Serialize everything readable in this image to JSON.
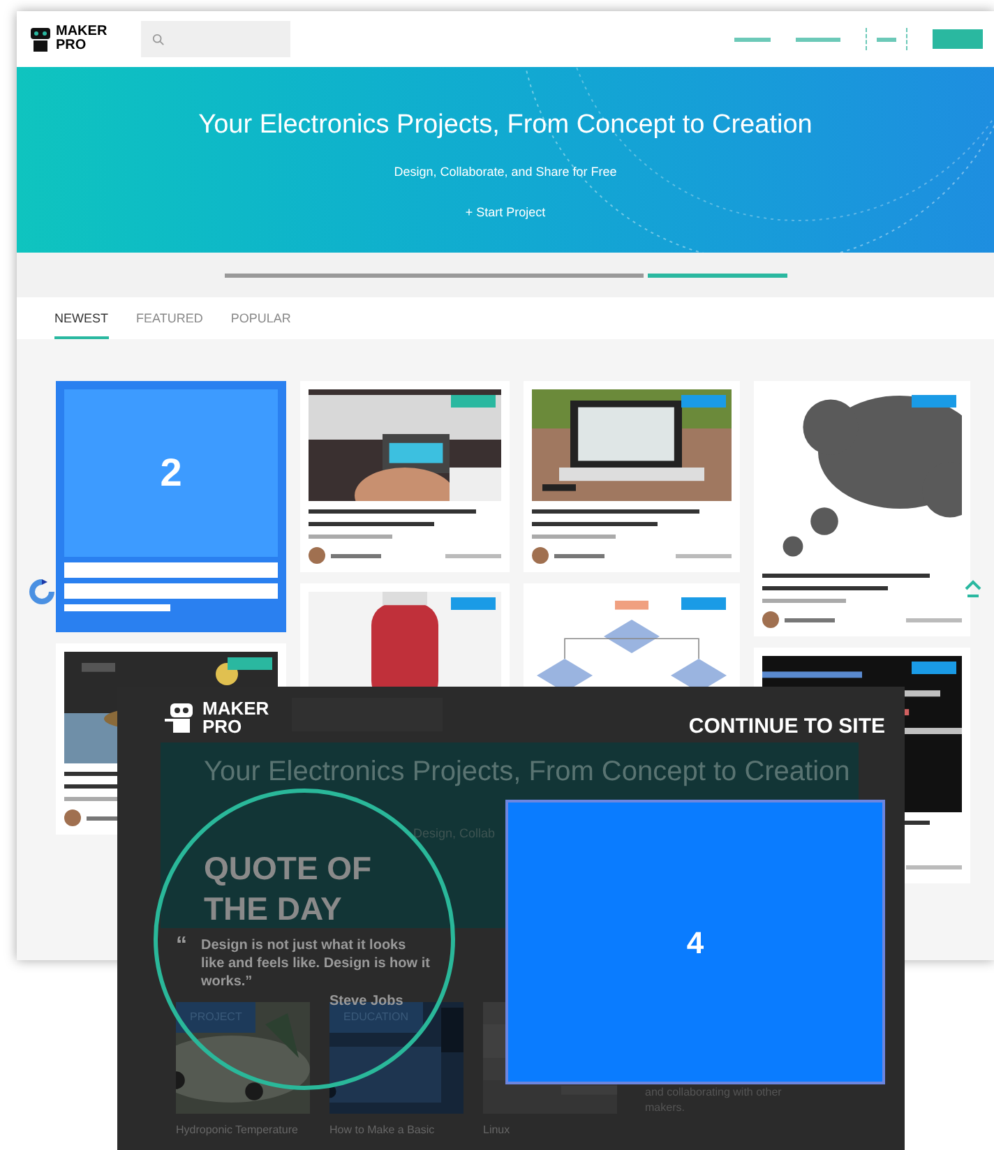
{
  "header": {
    "logo_top": "MAKER",
    "logo_bottom": "PRO"
  },
  "hero": {
    "title": "Your Electronics Projects, From Concept to Creation",
    "subtitle": "Design, Collaborate, and Share for Free",
    "button": "+ Start Project"
  },
  "tabs": [
    {
      "label": "NEWEST",
      "selected": true
    },
    {
      "label": "FEATURED",
      "selected": false
    },
    {
      "label": "POPULAR",
      "selected": false
    }
  ],
  "columns": [
    [
      {
        "kind": "placeholder",
        "number": "2"
      },
      {
        "kind": "card",
        "color": "#2ab8a0"
      }
    ],
    [
      {
        "kind": "card",
        "color": "#2ab8a0"
      },
      {
        "kind": "card",
        "color": "#1a9be6"
      }
    ],
    [
      {
        "kind": "card",
        "color": "#1a9be6"
      },
      {
        "kind": "card",
        "color": "#1a9be6"
      }
    ],
    [
      {
        "kind": "card",
        "color": "#1a9be6"
      },
      {
        "kind": "card",
        "color": "#1a9be6"
      }
    ]
  ],
  "overlay": {
    "logo_top": "MAKER",
    "logo_bottom": "PRO",
    "continue": "CONTINUE TO SITE",
    "dim_title": "Your Electronics Projects, From Concept to Creation",
    "dim_subtitle": "Design, Collab",
    "quote_heading": "QUOTE OF THE DAY",
    "quote_mark": "“",
    "quote": "Design is not just what it looks like and feels like. Design is how it works.”",
    "author": "Steve Jobs",
    "placeholder": "4",
    "dim_cards": [
      {
        "tag": "PROJECT",
        "title": "Hydroponic Temperature"
      },
      {
        "tag": "EDUCATION",
        "title": "How to Make a Basic"
      },
      {
        "title": "Linux"
      }
    ],
    "side_text": "and collaborating with other makers."
  }
}
